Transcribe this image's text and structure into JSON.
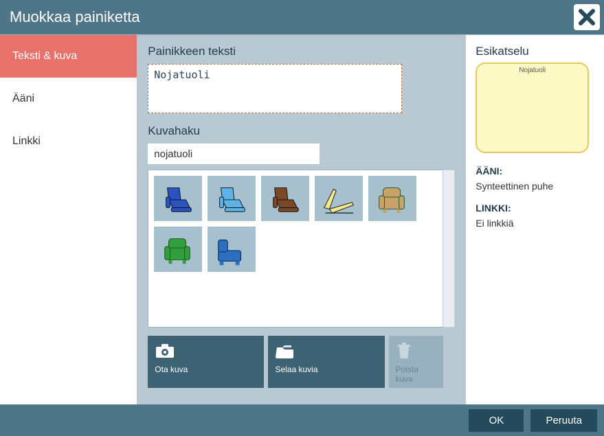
{
  "title": "Muokkaa painiketta",
  "sidebar": {
    "tabs": [
      {
        "label": "Teksti & kuva",
        "active": true
      },
      {
        "label": "Ääni",
        "active": false
      },
      {
        "label": "Linkki",
        "active": false
      }
    ]
  },
  "main": {
    "text_label": "Painikkeen teksti",
    "text_value": "Nojatuoli",
    "search_label": "Kuvahaku",
    "search_value": "nojatuoli",
    "images": [
      {
        "name": "recliner-blue",
        "color": "#2a52c1"
      },
      {
        "name": "recliner-lightblue",
        "color": "#5db3e6"
      },
      {
        "name": "recliner-brown",
        "color": "#7a4a26"
      },
      {
        "name": "lounger-yellow",
        "color": "#f6e98c"
      },
      {
        "name": "armchair-tan",
        "color": "#c9a26a"
      },
      {
        "name": "armchair-green",
        "color": "#2f9e3b"
      },
      {
        "name": "chaise-blue",
        "color": "#2d6fbf"
      }
    ],
    "actions": {
      "take_photo": "Ota kuva",
      "browse": "Selaa kuvia",
      "delete": "Poista kuva"
    }
  },
  "right": {
    "preview_label": "Esikatselu",
    "preview_text": "Nojatuoli",
    "sound_heading": "ÄÄNI:",
    "sound_value": "Synteettinen puhe",
    "link_heading": "LINKKI:",
    "link_value": "Ei linkkiä"
  },
  "footer": {
    "ok": "OK",
    "cancel": "Peruuta"
  }
}
